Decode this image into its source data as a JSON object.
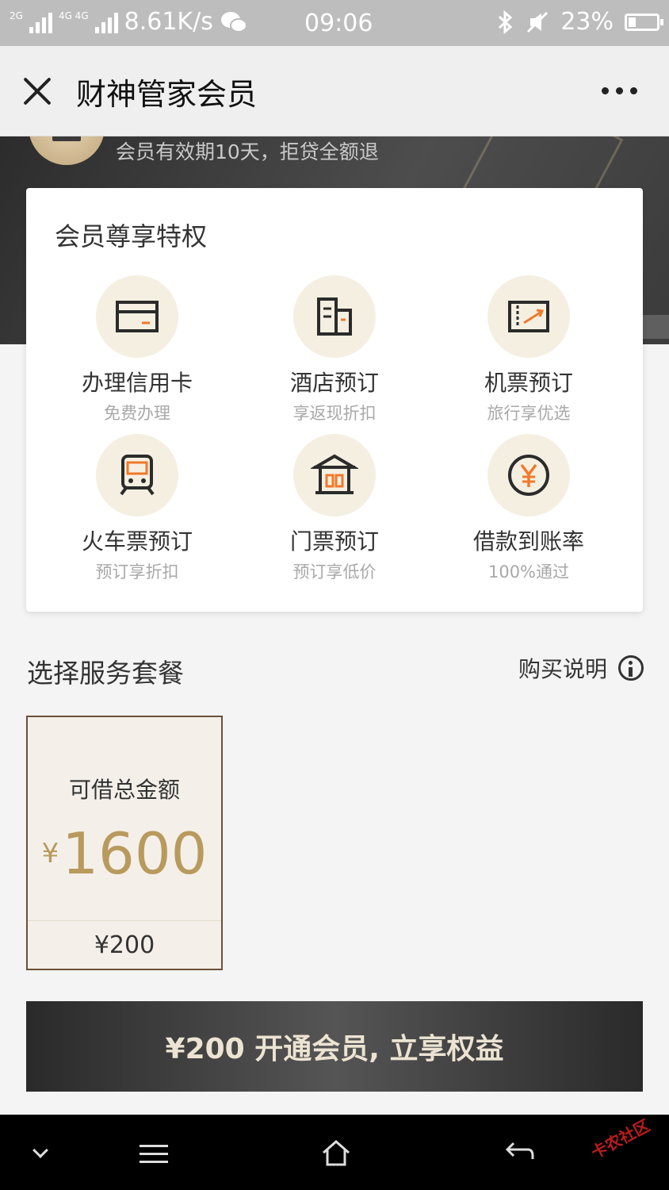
{
  "status_bar": {
    "net_small": "2G",
    "net_small2": "4G 4G",
    "speed": "8.61K/s",
    "time": "09:06",
    "battery": "23%"
  },
  "header": {
    "title": "财神管家会员"
  },
  "hero": {
    "subtitle": "会员有效期10天，拒贷全额退"
  },
  "privileges": {
    "title": "会员尊享特权",
    "items": [
      {
        "name": "办理信用卡",
        "desc": "免费办理",
        "icon": "credit-card-icon"
      },
      {
        "name": "酒店预订",
        "desc": "享返现折扣",
        "icon": "hotel-icon"
      },
      {
        "name": "机票预订",
        "desc": "旅行享优选",
        "icon": "flight-ticket-icon"
      },
      {
        "name": "火车票预订",
        "desc": "预订享折扣",
        "icon": "train-icon"
      },
      {
        "name": "门票预订",
        "desc": "预订享低价",
        "icon": "gate-ticket-icon"
      },
      {
        "name": "借款到账率",
        "desc": "100%通过",
        "icon": "yuan-coin-icon"
      }
    ]
  },
  "packages": {
    "section_title": "选择服务套餐",
    "buy_info": "购买说明",
    "items": [
      {
        "label": "可借总金额",
        "currency": "¥",
        "amount": "1600",
        "price": "¥200"
      }
    ]
  },
  "cta": {
    "label": "¥200 开通会员, 立享权益"
  },
  "watermark": "卡农社区",
  "colors": {
    "accent_gold": "#b99a5d",
    "icon_orange": "#f07a2b",
    "icon_circle": "#f5efe2",
    "card_border": "#6b5039"
  }
}
